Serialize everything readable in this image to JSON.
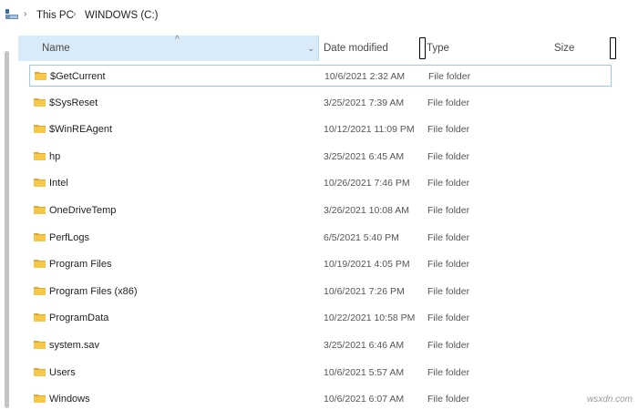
{
  "breadcrumb": {
    "items": [
      "This PC",
      "WINDOWS (C:)"
    ],
    "separator": "›"
  },
  "columns": {
    "name": "Name",
    "date_modified": "Date modified",
    "type": "Type",
    "size": "Size"
  },
  "sort": {
    "column": "name",
    "direction": "ascending"
  },
  "files": [
    {
      "name": "$GetCurrent",
      "date": "10/6/2021 2:32 AM",
      "type": "File folder",
      "selected": true
    },
    {
      "name": "$SysReset",
      "date": "3/25/2021 7:39 AM",
      "type": "File folder"
    },
    {
      "name": "$WinREAgent",
      "date": "10/12/2021 11:09 PM",
      "type": "File folder"
    },
    {
      "name": "hp",
      "date": "3/25/2021 6:45 AM",
      "type": "File folder"
    },
    {
      "name": "Intel",
      "date": "10/26/2021 7:46 PM",
      "type": "File folder"
    },
    {
      "name": "OneDriveTemp",
      "date": "3/26/2021 10:08 AM",
      "type": "File folder"
    },
    {
      "name": "PerfLogs",
      "date": "6/5/2021 5:40 PM",
      "type": "File folder"
    },
    {
      "name": "Program Files",
      "date": "10/19/2021 4:05 PM",
      "type": "File folder"
    },
    {
      "name": "Program Files (x86)",
      "date": "10/6/2021 7:26 PM",
      "type": "File folder"
    },
    {
      "name": "ProgramData",
      "date": "10/22/2021 10:58 PM",
      "type": "File folder"
    },
    {
      "name": "system.sav",
      "date": "3/25/2021 6:46 AM",
      "type": "File folder"
    },
    {
      "name": "Users",
      "date": "10/6/2021 5:57 AM",
      "type": "File folder"
    },
    {
      "name": "Windows",
      "date": "10/6/2021 6:07 AM",
      "type": "File folder"
    }
  ],
  "icons": {
    "folder": "folder-icon",
    "pc": "this-pc-icon"
  },
  "colors": {
    "folder": "#f5c84c",
    "folder_dark": "#e0a82e",
    "header_hover": "#d9ebf9",
    "selection_border": "#99c9ef"
  },
  "watermark": "wsxdn.com"
}
